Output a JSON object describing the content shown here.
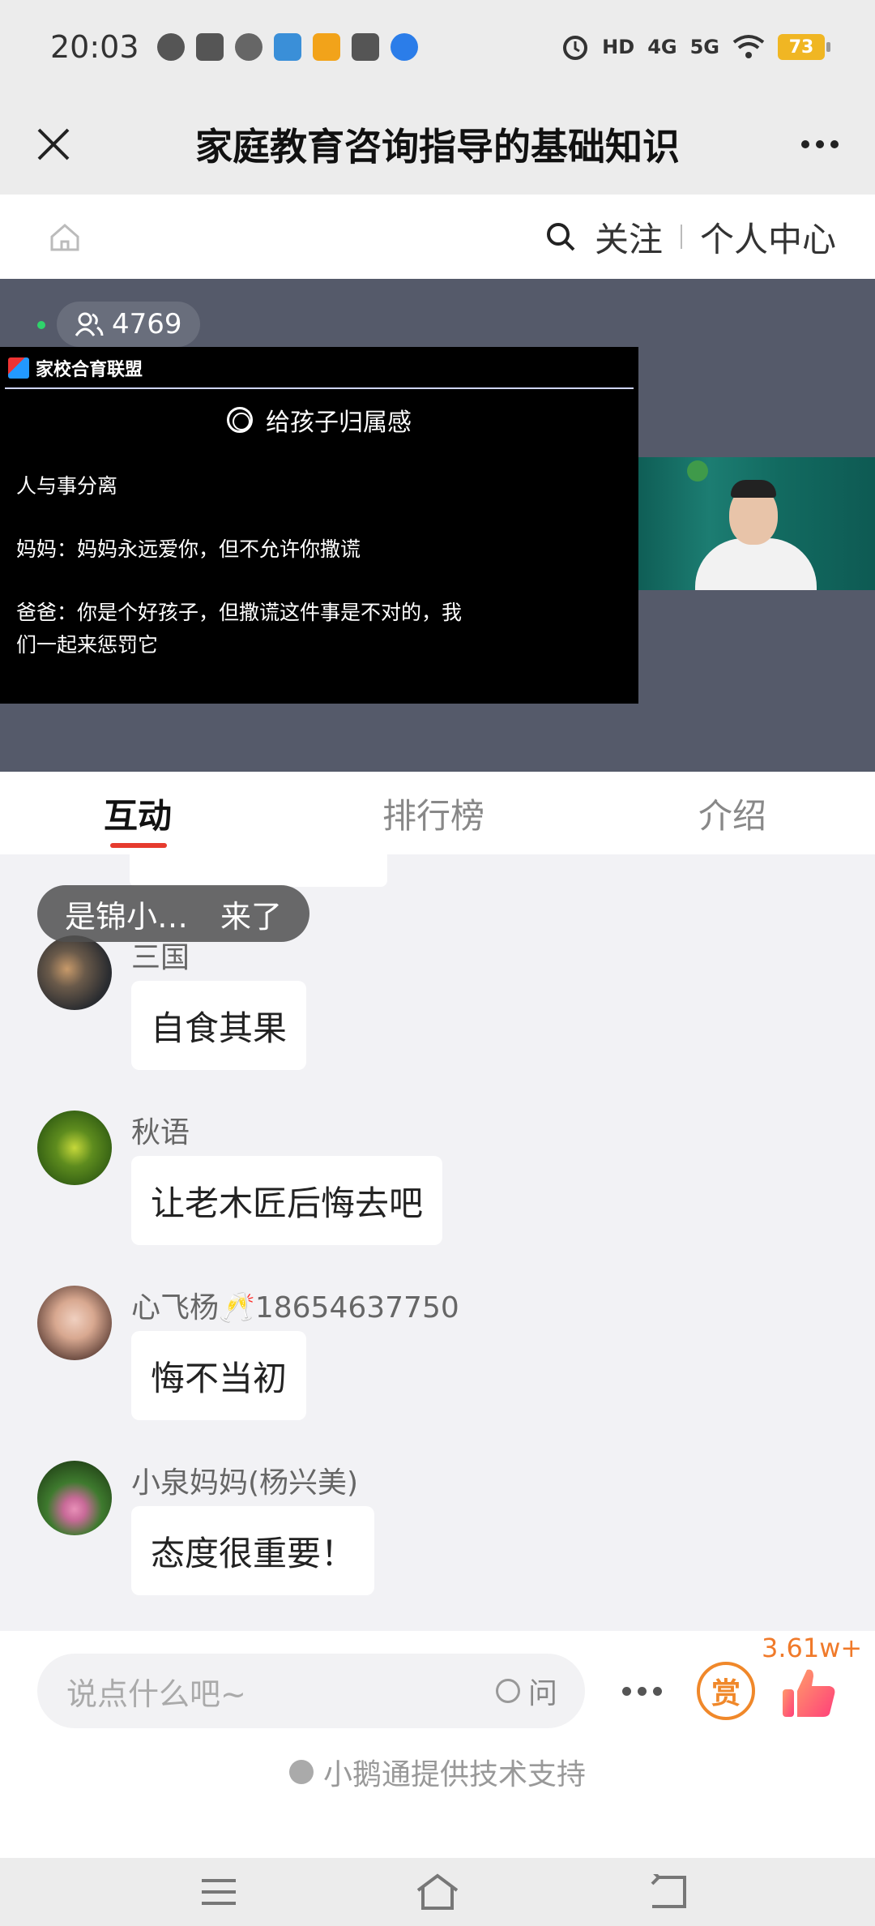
{
  "status_bar": {
    "time": "20:03",
    "network_1": "HD",
    "network_2": "4G",
    "network_3": "5G",
    "battery": "73"
  },
  "header": {
    "title": "家庭教育咨询指导的基础知识"
  },
  "nav": {
    "follow": "关注",
    "profile": "个人中心"
  },
  "live": {
    "online_count": "4769",
    "slide": {
      "brand": "家校合育联盟",
      "heading": "给孩子归属感",
      "lines": [
        "人与事分离",
        "妈妈：妈妈永远爱你，但不允许你撒谎",
        "爸爸：你是个好孩子，但撒谎这件事是不对的，我",
        "们一起来惩罚它"
      ]
    }
  },
  "tabs": [
    {
      "label": "互动",
      "active": true
    },
    {
      "label": "排行榜",
      "active": false
    },
    {
      "label": "介绍",
      "active": false
    }
  ],
  "chat": {
    "join_toast": {
      "name": "是锦小…",
      "action": "来了"
    },
    "messages": [
      {
        "name": "三国",
        "text": "自食其果",
        "avatar": "sunset"
      },
      {
        "name": "秋语",
        "text": "让老木匠后悔去吧",
        "avatar": "green-plant"
      },
      {
        "name": "心飞杨🥂18654637750",
        "text": "悔不当初",
        "avatar": "portrait"
      },
      {
        "name": "小泉妈妈(杨兴美)",
        "text": "态度很重要！",
        "avatar": "lotus"
      }
    ]
  },
  "bottom_bar": {
    "placeholder": "说点什么吧~",
    "ask_label": "问",
    "reward_label": "赏",
    "like_count": "3.61w+",
    "tech_support": "小鹅通提供技术支持"
  },
  "colors": {
    "accent_red": "#e63b2e",
    "reward_orange": "#f0882a",
    "battery_yellow": "#f0b623",
    "video_bg": "#555a6a"
  }
}
